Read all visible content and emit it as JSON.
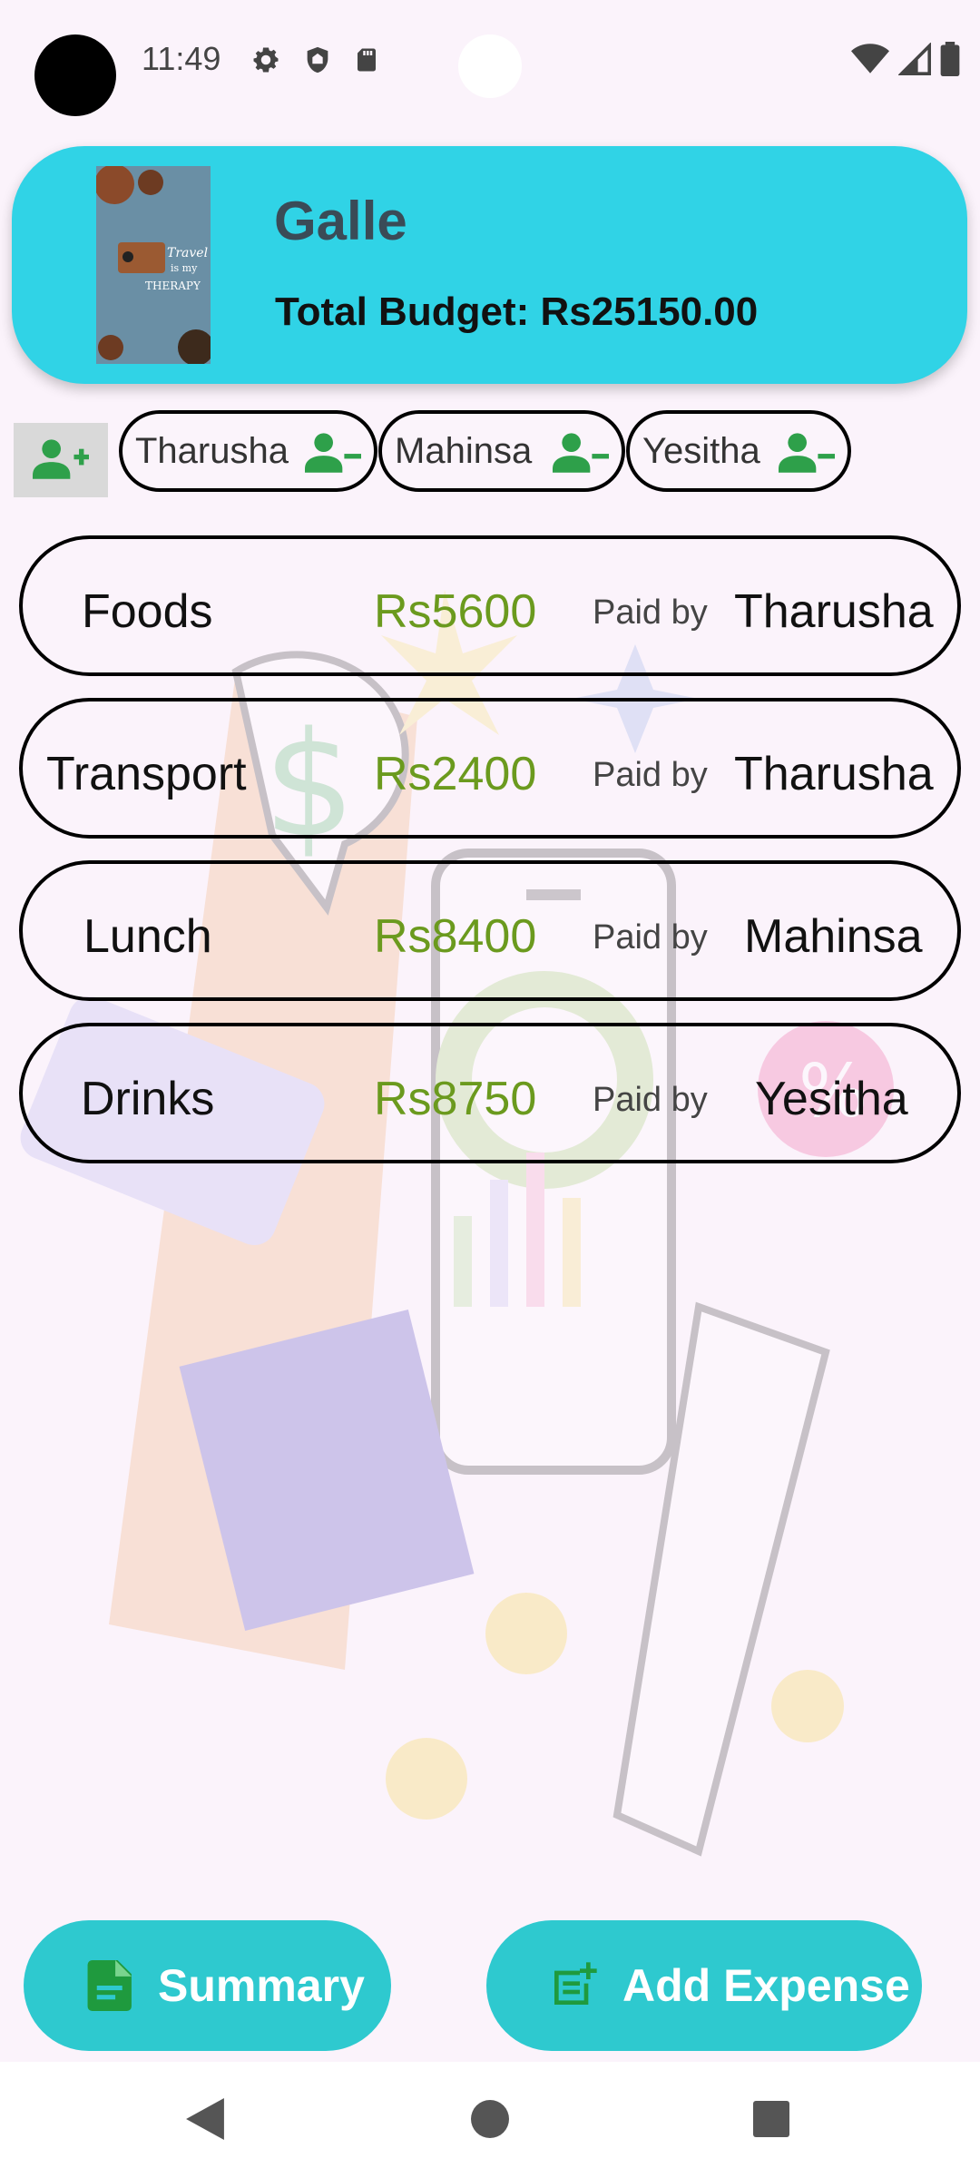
{
  "status_bar": {
    "time": "11:49",
    "left_icons": [
      "gear-icon",
      "shield-icon",
      "sd-card-icon"
    ],
    "right_icons": [
      "wifi-icon",
      "signal-icon",
      "battery-icon"
    ]
  },
  "trip": {
    "title": "Galle",
    "budget_label": "Total Budget: Rs25150.00",
    "cover_text": [
      "Travel",
      "is my",
      "THERAPY"
    ]
  },
  "members": {
    "add_icon": "add-person-icon",
    "remove_icon": "remove-person-icon",
    "items": [
      {
        "name": "Tharusha"
      },
      {
        "name": "Mahinsa"
      },
      {
        "name": "Yesitha"
      }
    ]
  },
  "expenses": {
    "paid_by_label": "Paid by",
    "items": [
      {
        "name": "Foods",
        "amount": "Rs5600",
        "payer": "Tharusha"
      },
      {
        "name": "Transport",
        "amount": "Rs2400",
        "payer": "Tharusha"
      },
      {
        "name": "Lunch",
        "amount": "Rs8400",
        "payer": "Mahinsa"
      },
      {
        "name": "Drinks",
        "amount": "Rs8750",
        "payer": "Yesitha"
      }
    ]
  },
  "actions": {
    "summary_label": "Summary",
    "summary_icon": "document-icon",
    "add_expense_label": "Add Expense",
    "add_expense_icon": "add-note-icon"
  },
  "nav": {
    "back_icon": "back-triangle-icon",
    "home_icon": "home-circle-icon",
    "recents_icon": "recents-square-icon"
  },
  "colors": {
    "header": "#30d3e6",
    "amount": "#6b9a1e",
    "action_button": "#2ec9cf",
    "member_icon": "#2ea04a"
  }
}
